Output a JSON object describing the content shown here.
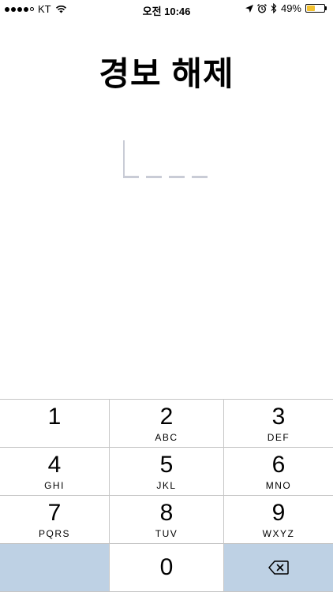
{
  "status_bar": {
    "carrier": "KT",
    "time": "오전 10:46",
    "battery_percent": "49%",
    "battery_level": 0.49,
    "signal_bars_filled": 4,
    "signal_bars_total": 5
  },
  "title": "경보 해제",
  "pin": {
    "length": 4,
    "entered": 0
  },
  "keypad": {
    "keys": [
      {
        "num": "1",
        "letters": ""
      },
      {
        "num": "2",
        "letters": "ABC"
      },
      {
        "num": "3",
        "letters": "DEF"
      },
      {
        "num": "4",
        "letters": "GHI"
      },
      {
        "num": "5",
        "letters": "JKL"
      },
      {
        "num": "6",
        "letters": "MNO"
      },
      {
        "num": "7",
        "letters": "PQRS"
      },
      {
        "num": "8",
        "letters": "TUV"
      },
      {
        "num": "9",
        "letters": "WXYZ"
      },
      {
        "num": "0",
        "letters": ""
      }
    ],
    "delete_icon": "backspace-icon"
  },
  "colors": {
    "accent_key": "#bed1e4",
    "battery": "#f2c12e",
    "pin_placeholder": "#c9ccd6"
  }
}
